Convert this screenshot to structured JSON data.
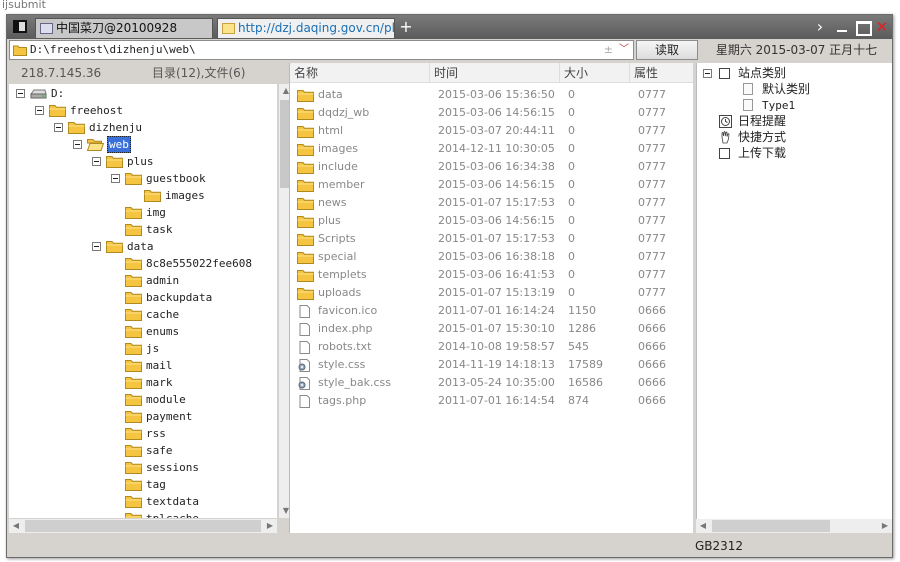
{
  "background": {
    "left_text": "ijsubmit",
    "right_text": ""
  },
  "titlebar": {
    "tabs": [
      {
        "label": "中国菜刀@20100928"
      },
      {
        "label": "http://dzj.daqing.gov.cn/plus..."
      }
    ],
    "add_label": "+",
    "next_label": "›",
    "close_label": "✕"
  },
  "toolbar": {
    "path": "D:\\freehost\\dizhenju\\web\\",
    "read_label": "读取",
    "date": "星期六 2015-03-07 正月十七"
  },
  "left_panel": {
    "ip": "218.7.145.36",
    "count": "目录(12),文件(6)"
  },
  "tree": [
    {
      "label": "D:",
      "level": 0,
      "type": "drive",
      "toggle": true
    },
    {
      "label": "freehost",
      "level": 1,
      "type": "folder",
      "toggle": true
    },
    {
      "label": "dizhenju",
      "level": 2,
      "type": "folder",
      "toggle": true
    },
    {
      "label": "web",
      "level": 3,
      "type": "folder-open",
      "toggle": true,
      "selected": true
    },
    {
      "label": "plus",
      "level": 4,
      "type": "folder",
      "toggle": true
    },
    {
      "label": "guestbook",
      "level": 5,
      "type": "folder",
      "toggle": true
    },
    {
      "label": "images",
      "level": 6,
      "type": "folder",
      "toggle": false
    },
    {
      "label": "img",
      "level": 5,
      "type": "folder",
      "toggle": false
    },
    {
      "label": "task",
      "level": 5,
      "type": "folder",
      "toggle": false
    },
    {
      "label": "data",
      "level": 4,
      "type": "folder",
      "toggle": true
    },
    {
      "label": "8c8e555022fee608",
      "level": 5,
      "type": "folder",
      "toggle": false
    },
    {
      "label": "admin",
      "level": 5,
      "type": "folder",
      "toggle": false
    },
    {
      "label": "backupdata",
      "level": 5,
      "type": "folder",
      "toggle": false
    },
    {
      "label": "cache",
      "level": 5,
      "type": "folder",
      "toggle": false
    },
    {
      "label": "enums",
      "level": 5,
      "type": "folder",
      "toggle": false
    },
    {
      "label": "js",
      "level": 5,
      "type": "folder",
      "toggle": false
    },
    {
      "label": "mail",
      "level": 5,
      "type": "folder",
      "toggle": false
    },
    {
      "label": "mark",
      "level": 5,
      "type": "folder",
      "toggle": false
    },
    {
      "label": "module",
      "level": 5,
      "type": "folder",
      "toggle": false
    },
    {
      "label": "payment",
      "level": 5,
      "type": "folder",
      "toggle": false
    },
    {
      "label": "rss",
      "level": 5,
      "type": "folder",
      "toggle": false
    },
    {
      "label": "safe",
      "level": 5,
      "type": "folder",
      "toggle": false
    },
    {
      "label": "sessions",
      "level": 5,
      "type": "folder",
      "toggle": false
    },
    {
      "label": "tag",
      "level": 5,
      "type": "folder",
      "toggle": false
    },
    {
      "label": "textdata",
      "level": 5,
      "type": "folder",
      "toggle": false
    },
    {
      "label": "tplcache",
      "level": 5,
      "type": "folder",
      "toggle": false
    }
  ],
  "file_columns": [
    "名称",
    "时间",
    "大小",
    "属性"
  ],
  "files": [
    {
      "icon": "folder",
      "name": "data",
      "time": "2015-03-06 15:36:50",
      "size": "0",
      "attr": "0777"
    },
    {
      "icon": "folder",
      "name": "dqdzj_wb",
      "time": "2015-03-06 14:56:15",
      "size": "0",
      "attr": "0777"
    },
    {
      "icon": "folder",
      "name": "html",
      "time": "2015-03-07 20:44:11",
      "size": "0",
      "attr": "0777"
    },
    {
      "icon": "folder",
      "name": "images",
      "time": "2014-12-11 10:30:05",
      "size": "0",
      "attr": "0777"
    },
    {
      "icon": "folder",
      "name": "include",
      "time": "2015-03-06 16:34:38",
      "size": "0",
      "attr": "0777"
    },
    {
      "icon": "folder",
      "name": "member",
      "time": "2015-03-06 14:56:15",
      "size": "0",
      "attr": "0777"
    },
    {
      "icon": "folder",
      "name": "news",
      "time": "2015-01-07 15:17:53",
      "size": "0",
      "attr": "0777"
    },
    {
      "icon": "folder",
      "name": "plus",
      "time": "2015-03-06 14:56:15",
      "size": "0",
      "attr": "0777"
    },
    {
      "icon": "folder",
      "name": "Scripts",
      "time": "2015-01-07 15:17:53",
      "size": "0",
      "attr": "0777"
    },
    {
      "icon": "folder",
      "name": "special",
      "time": "2015-03-06 16:38:18",
      "size": "0",
      "attr": "0777"
    },
    {
      "icon": "folder",
      "name": "templets",
      "time": "2015-03-06 16:41:53",
      "size": "0",
      "attr": "0777"
    },
    {
      "icon": "folder",
      "name": "uploads",
      "time": "2015-01-07 15:13:19",
      "size": "0",
      "attr": "0777"
    },
    {
      "icon": "file",
      "name": "favicon.ico",
      "time": "2011-07-01 16:14:24",
      "size": "1150",
      "attr": "0666"
    },
    {
      "icon": "file",
      "name": "index.php",
      "time": "2015-01-07 15:30:10",
      "size": "1286",
      "attr": "0666"
    },
    {
      "icon": "file",
      "name": "robots.txt",
      "time": "2014-10-08 19:58:57",
      "size": "545",
      "attr": "0666"
    },
    {
      "icon": "css",
      "name": "style.css",
      "time": "2014-11-19 14:18:13",
      "size": "17589",
      "attr": "0666"
    },
    {
      "icon": "css",
      "name": "style_bak.css",
      "time": "2013-05-24 10:35:00",
      "size": "16586",
      "attr": "0666"
    },
    {
      "icon": "file",
      "name": "tags.php",
      "time": "2011-07-01 16:14:54",
      "size": "874",
      "attr": "0666"
    }
  ],
  "sites": [
    {
      "label": "站点类别",
      "level": 0,
      "kind": "box",
      "toggle": true
    },
    {
      "label": "默认类别",
      "level": 1,
      "kind": "page",
      "toggle": false
    },
    {
      "label": "Type1",
      "level": 1,
      "kind": "page",
      "toggle": false,
      "mono": true
    },
    {
      "label": "日程提醒",
      "level": 0,
      "kind": "clock",
      "toggle": false
    },
    {
      "label": "快捷方式",
      "level": 0,
      "kind": "hand",
      "toggle": false
    },
    {
      "label": "上传下载",
      "level": 0,
      "kind": "box",
      "toggle": false
    }
  ],
  "status": {
    "encoding": "GB2312"
  },
  "colors": {
    "folder": "#f5c542",
    "selection": "#3a70d8",
    "titlebar": "#6a6a6a"
  }
}
